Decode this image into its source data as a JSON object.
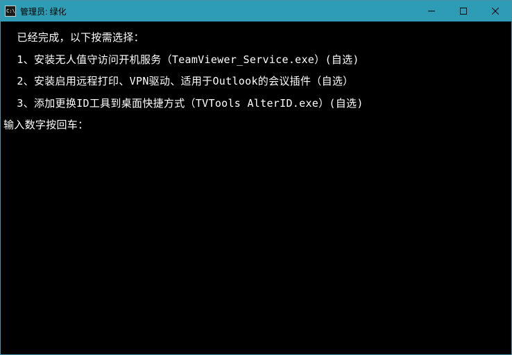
{
  "titlebar": {
    "icon_text": "C:\\",
    "title": "管理员:  绿化"
  },
  "terminal": {
    "header": " 已经完成，以下按需选择：",
    "options": [
      " 1、安装无人值守访问开机服务（TeamViewer_Service.exe）(自选)",
      " 2、安装启用远程打印、VPN驱动、适用于Outlook的会议插件（自选）",
      " 3、添加更换ID工具到桌面快捷方式（TVTools AlterID.exe）(自选)"
    ],
    "prompt": "输入数字按回车："
  }
}
